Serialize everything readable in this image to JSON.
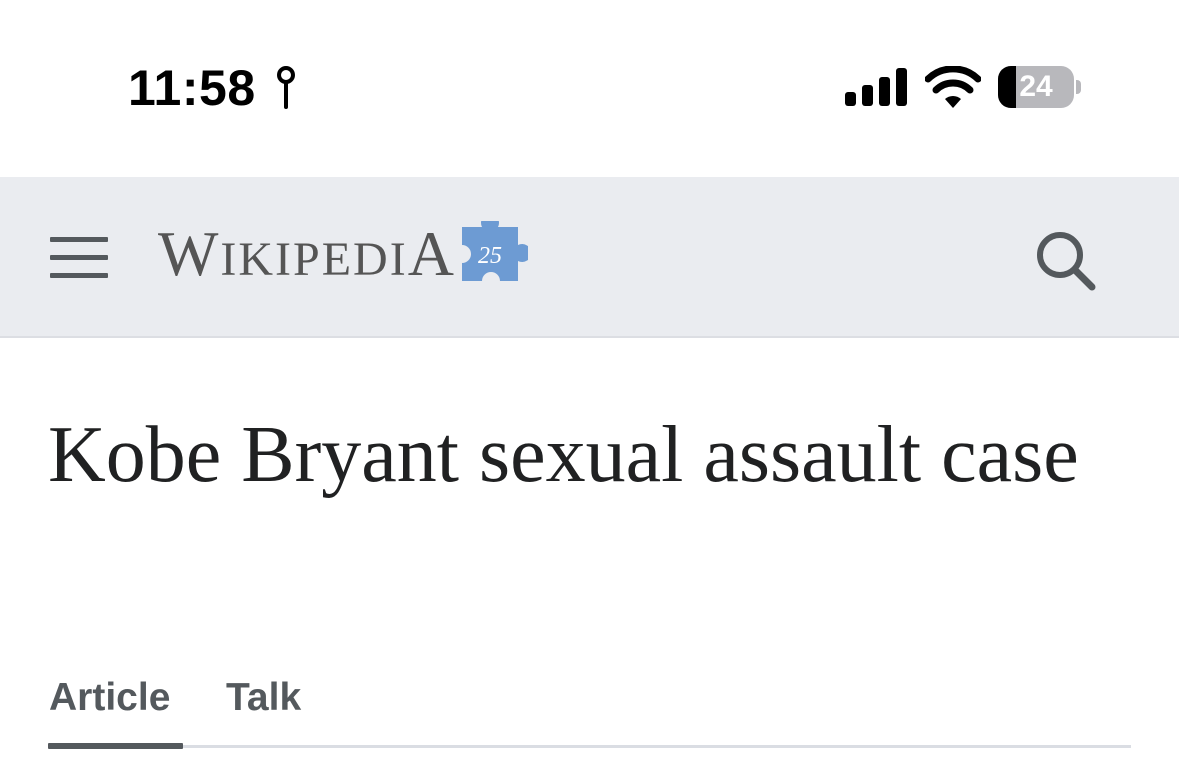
{
  "status_bar": {
    "time": "11:58",
    "battery_percent": "24",
    "battery_level": 0.24,
    "icons": [
      "location-icon",
      "cellular-signal-icon",
      "wifi-icon",
      "battery-icon"
    ]
  },
  "header": {
    "menu_icon": "hamburger-menu-icon",
    "logo_first": "W",
    "logo_rest": "IKIPEDI",
    "logo_last": "A",
    "anniversary_badge": "25",
    "search_icon": "search-icon",
    "background": "#eaecf0"
  },
  "article": {
    "title": "Kobe Bryant sexual assault case"
  },
  "tabs": [
    {
      "label": "Article",
      "selected": true
    },
    {
      "label": "Talk",
      "selected": false
    }
  ],
  "colors": {
    "text": "#202122",
    "tab_text": "#54595d",
    "puzzle": "#6d9bd3"
  }
}
